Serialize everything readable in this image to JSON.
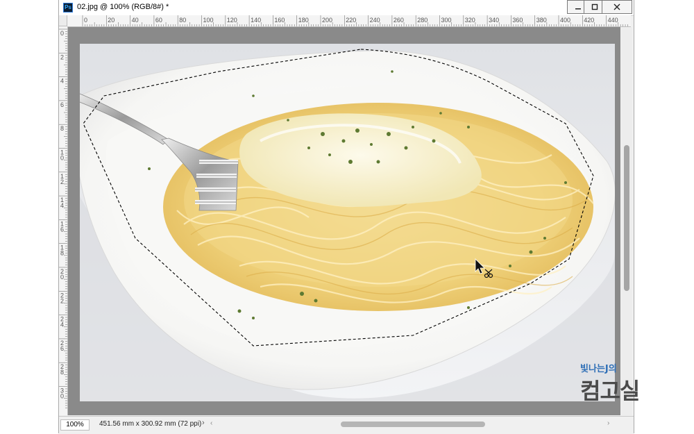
{
  "window": {
    "title": "02.jpg @ 100% (RGB/8#) *",
    "app_icon_label": "Ps",
    "controls": [
      "minimize-icon",
      "maximize-icon",
      "close-icon"
    ]
  },
  "ruler": {
    "top_labels": [
      "0",
      "20",
      "40",
      "60",
      "80",
      "100",
      "120",
      "140",
      "160",
      "180",
      "200",
      "220",
      "240",
      "260",
      "280",
      "300",
      "320",
      "340",
      "360",
      "380",
      "400",
      "420",
      "440"
    ],
    "left_labels": [
      "0",
      "2",
      "4",
      "6",
      "8",
      "10",
      "12",
      "14",
      "16",
      "18",
      "20",
      "22",
      "24",
      "26",
      "28",
      "30"
    ]
  },
  "status": {
    "zoom": "100%",
    "doc_info": "451.56 mm x 300.92 mm (72 ppi)",
    "arrow": "›"
  },
  "watermark": {
    "top": "빛나는J의",
    "bottom": "컴고실",
    "color_top": "#2f6fb6",
    "color_bottom": "#4a4a4a"
  },
  "colors": {
    "canvas_bg": "#8a8a8a",
    "pasta": "#f3d98a",
    "sauce": "#fbf6dc",
    "plate": "#ffffff"
  },
  "tool": {
    "cursor": "magnetic-lasso-scissors-icon"
  }
}
